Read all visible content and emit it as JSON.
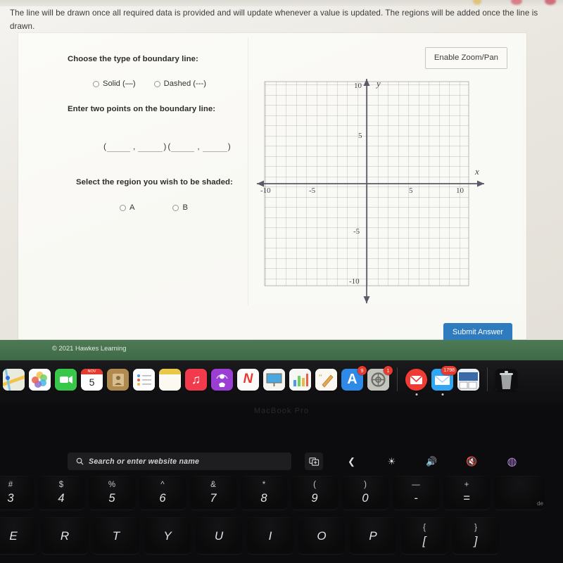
{
  "page": {
    "instructions": "The line will be drawn once all required data is provided and will update whenever a value is updated. The regions will be added once the line is drawn.",
    "footer_copyright": "© 2021 Hawkes Learning"
  },
  "form": {
    "boundary_label": "Choose the type of boundary line:",
    "boundary_options": [
      {
        "label": "Solid (—)",
        "selected": false
      },
      {
        "label": "Dashed (---)",
        "selected": false
      }
    ],
    "points_label": "Enter two points on the boundary line:",
    "points": [
      {
        "open": "(",
        "x": "",
        "comma": ",",
        "y": "",
        "close": ")"
      },
      {
        "open": "(",
        "x": "",
        "comma": ",",
        "y": "",
        "close": ")"
      }
    ],
    "region_label": "Select the region you wish to be shaded:",
    "region_options": [
      {
        "label": "A",
        "selected": false
      },
      {
        "label": "B",
        "selected": false
      }
    ]
  },
  "graph": {
    "zoom_pan_button": "Enable Zoom/Pan",
    "x_axis_label": "x",
    "y_axis_label": "y",
    "x_ticks": [
      "-10",
      "-5",
      "5",
      "10"
    ],
    "y_ticks": [
      "10",
      "5",
      "-5",
      "-10"
    ],
    "grid_on": true,
    "axis_min": -10,
    "axis_max": 10,
    "cursor_icon": "mouse-pointer-icon"
  },
  "actions": {
    "submit_label": "Submit Answer"
  },
  "colors": {
    "submit_blue": "#2e7bbf",
    "footer_green": "#3f6a48",
    "badge_red": "#e8392f"
  },
  "dock": {
    "items": [
      {
        "name": "maps",
        "icon": "maps-icon",
        "glyph": "",
        "bg": "#eef1e6",
        "running": false,
        "badge": ""
      },
      {
        "name": "photos",
        "icon": "photos-icon",
        "glyph": "✿",
        "bg": "#fdfdfd",
        "running": false,
        "badge": ""
      },
      {
        "name": "facetime",
        "icon": "facetime-icon",
        "glyph": "▣",
        "bg": "#37c84a",
        "running": false,
        "badge": ""
      },
      {
        "name": "calendar",
        "icon": "calendar-icon",
        "glyph": "5",
        "bg": "#ffffff",
        "running": false,
        "badge": "",
        "month": "NOV",
        "day": "5"
      },
      {
        "name": "contacts",
        "icon": "contacts-icon",
        "glyph": "☺",
        "bg": "#b08a4e",
        "running": false,
        "badge": ""
      },
      {
        "name": "reminders",
        "icon": "reminders-icon",
        "glyph": "☰",
        "bg": "#fbfbfb",
        "running": false,
        "badge": ""
      },
      {
        "name": "notes",
        "icon": "notes-icon",
        "glyph": "",
        "bg": "#fbf7e3",
        "running": false,
        "badge": ""
      },
      {
        "name": "music",
        "icon": "music-icon",
        "glyph": "♫",
        "bg": "#f23a4d",
        "running": false,
        "badge": ""
      },
      {
        "name": "podcasts",
        "icon": "podcasts-icon",
        "glyph": "◉",
        "bg": "#9b3fd4",
        "running": false,
        "badge": ""
      },
      {
        "name": "news",
        "icon": "news-icon",
        "glyph": "N",
        "bg": "#fbfbfb",
        "running": false,
        "badge": ""
      },
      {
        "name": "keynote",
        "icon": "keynote-icon",
        "glyph": "▭",
        "bg": "#f2f2f0",
        "running": false,
        "badge": ""
      },
      {
        "name": "numbers",
        "icon": "numbers-icon",
        "glyph": "▥",
        "bg": "#f6f6f4",
        "running": false,
        "badge": ""
      },
      {
        "name": "pages",
        "icon": "pages-icon",
        "glyph": "✎",
        "bg": "#f8f6ef",
        "running": false,
        "badge": ""
      },
      {
        "name": "app-store",
        "icon": "app-store-icon",
        "glyph": "A",
        "bg": "#2e8ae6",
        "running": false,
        "badge": "9"
      },
      {
        "name": "system-preferences",
        "icon": "system-preferences-icon",
        "glyph": "⚙",
        "bg": "#c9c9c4",
        "running": false,
        "badge": "1"
      },
      {
        "name": "gmail",
        "icon": "gmail-icon",
        "glyph": "✉",
        "bg": "#ee3b33",
        "running": true,
        "badge": ""
      },
      {
        "name": "mail",
        "icon": "mail-icon",
        "glyph": "✉",
        "bg": "#31a6f2",
        "running": true,
        "badge": "1798"
      },
      {
        "name": "preview",
        "icon": "preview-icon",
        "glyph": "▤",
        "bg": "#dfe6ee",
        "running": false,
        "badge": ""
      },
      {
        "name": "trash",
        "icon": "trash-icon",
        "glyph": "🗑",
        "bg": "#9c9c9c",
        "running": false,
        "badge": ""
      }
    ],
    "device_label": "MacBook Pro"
  },
  "touchbar": {
    "search_placeholder": "Search or enter website name",
    "search_icon": "search-icon",
    "new_tab_icon": "new-tab-icon",
    "controls": [
      {
        "name": "back",
        "icon": "chevron-left-icon",
        "glyph": "❮"
      },
      {
        "name": "brightness",
        "icon": "brightness-icon",
        "glyph": "☀"
      },
      {
        "name": "volume-up",
        "icon": "volume-up-icon",
        "glyph": "🔊"
      },
      {
        "name": "mute",
        "icon": "volume-mute-icon",
        "glyph": "🔇"
      },
      {
        "name": "siri",
        "icon": "siri-icon",
        "glyph": "◍"
      }
    ]
  },
  "keyboard": {
    "number_row": [
      {
        "top": "#",
        "main": "3"
      },
      {
        "top": "$",
        "main": "4"
      },
      {
        "top": "%",
        "main": "5"
      },
      {
        "top": "^",
        "main": "6"
      },
      {
        "top": "&",
        "main": "7"
      },
      {
        "top": "*",
        "main": "8"
      },
      {
        "top": "(",
        "main": "9"
      },
      {
        "top": ")",
        "main": "0"
      },
      {
        "top": "—",
        "main": "-"
      },
      {
        "top": "+",
        "main": "="
      },
      {
        "top": "",
        "main": "",
        "edge": "de"
      }
    ],
    "letter_row": [
      {
        "top": "",
        "main": "E"
      },
      {
        "top": "",
        "main": "R"
      },
      {
        "top": "",
        "main": "T"
      },
      {
        "top": "",
        "main": "Y"
      },
      {
        "top": "",
        "main": "U"
      },
      {
        "top": "",
        "main": "I"
      },
      {
        "top": "",
        "main": "O"
      },
      {
        "top": "",
        "main": "P"
      },
      {
        "top": "{",
        "main": "["
      },
      {
        "top": "}",
        "main": "]"
      }
    ]
  }
}
